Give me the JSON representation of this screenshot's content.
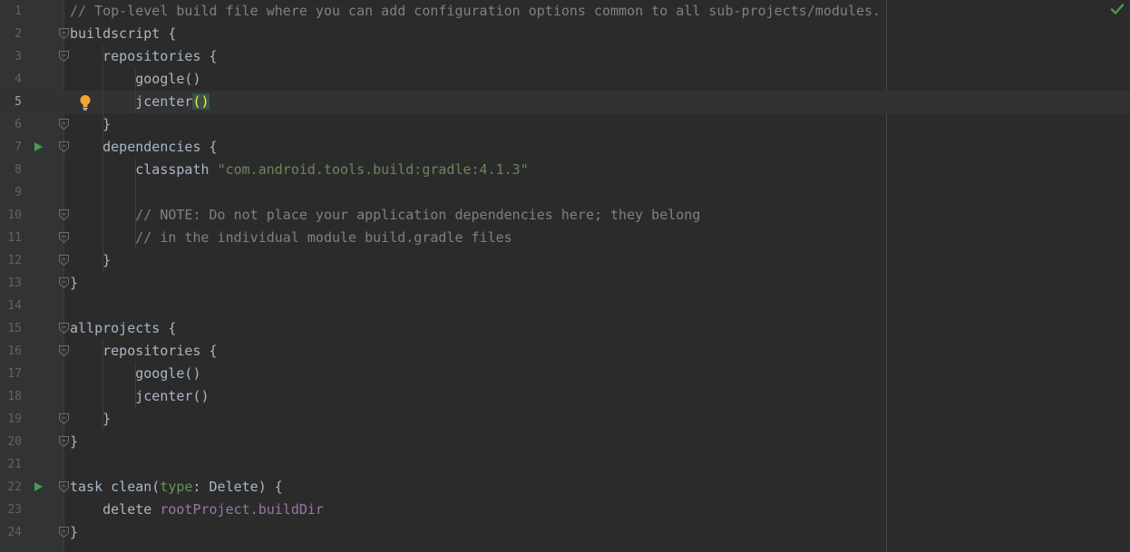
{
  "editor": {
    "status_icon": "check-icon",
    "status_color": "#499c54",
    "caret_line": 5,
    "colors": {
      "background": "#2b2b2b",
      "gutter": "#313335",
      "text": "#a9b7c6",
      "comment": "#808080",
      "string": "#6a8759",
      "property": "#9876aa",
      "run": "#499c54",
      "bulb": "#f0a732"
    },
    "lines": [
      {
        "number": "1",
        "tokens": [
          {
            "t": "// Top-level build file where you can add configuration options common to all sub-projects/modules.",
            "c": "comment"
          }
        ]
      },
      {
        "number": "2",
        "fold": true,
        "tokens": [
          {
            "t": "buildscript {",
            "c": "plain"
          }
        ]
      },
      {
        "number": "3",
        "fold": true,
        "tokens": [
          {
            "t": "    repositories {",
            "c": "plain"
          }
        ]
      },
      {
        "number": "4",
        "tokens": [
          {
            "t": "        google()",
            "c": "plain"
          }
        ]
      },
      {
        "number": "5",
        "current": true,
        "bulb": true,
        "tokens": [
          {
            "t": "        jcenter",
            "c": "plain"
          },
          {
            "t": "()",
            "c": "brace-match"
          }
        ]
      },
      {
        "number": "6",
        "fold": true,
        "tokens": [
          {
            "t": "    }",
            "c": "plain"
          }
        ]
      },
      {
        "number": "7",
        "run": true,
        "fold": true,
        "tokens": [
          {
            "t": "    dependencies {",
            "c": "plain"
          }
        ]
      },
      {
        "number": "8",
        "tokens": [
          {
            "t": "        classpath ",
            "c": "plain"
          },
          {
            "t": "\"com.android.tools.build:gradle:4.1.3\"",
            "c": "string"
          }
        ]
      },
      {
        "number": "9",
        "tokens": []
      },
      {
        "number": "10",
        "fold": true,
        "tokens": [
          {
            "t": "        // NOTE: Do not place your application dependencies here; they belong",
            "c": "comment"
          }
        ]
      },
      {
        "number": "11",
        "fold": true,
        "tokens": [
          {
            "t": "        // in the individual module build.gradle files",
            "c": "comment"
          }
        ]
      },
      {
        "number": "12",
        "fold": true,
        "tokens": [
          {
            "t": "    }",
            "c": "plain"
          }
        ]
      },
      {
        "number": "13",
        "fold": true,
        "tokens": [
          {
            "t": "}",
            "c": "plain"
          }
        ]
      },
      {
        "number": "14",
        "tokens": []
      },
      {
        "number": "15",
        "fold": true,
        "tokens": [
          {
            "t": "allprojects {",
            "c": "plain"
          }
        ]
      },
      {
        "number": "16",
        "fold": true,
        "tokens": [
          {
            "t": "    repositories {",
            "c": "plain"
          }
        ]
      },
      {
        "number": "17",
        "tokens": [
          {
            "t": "        google()",
            "c": "plain"
          }
        ]
      },
      {
        "number": "18",
        "tokens": [
          {
            "t": "        jcenter()",
            "c": "plain"
          }
        ]
      },
      {
        "number": "19",
        "fold": true,
        "tokens": [
          {
            "t": "    }",
            "c": "plain"
          }
        ]
      },
      {
        "number": "20",
        "fold": true,
        "tokens": [
          {
            "t": "}",
            "c": "plain"
          }
        ]
      },
      {
        "number": "21",
        "tokens": []
      },
      {
        "number": "22",
        "run": true,
        "fold": true,
        "tokens": [
          {
            "t": "task clean(",
            "c": "plain"
          },
          {
            "t": "type",
            "c": "param"
          },
          {
            "t": ": Delete) {",
            "c": "plain"
          }
        ]
      },
      {
        "number": "23",
        "tokens": [
          {
            "t": "    delete ",
            "c": "plain"
          },
          {
            "t": "rootProject.buildDir",
            "c": "prop"
          }
        ]
      },
      {
        "number": "24",
        "fold": true,
        "tokens": [
          {
            "t": "}",
            "c": "plain"
          }
        ]
      }
    ]
  }
}
